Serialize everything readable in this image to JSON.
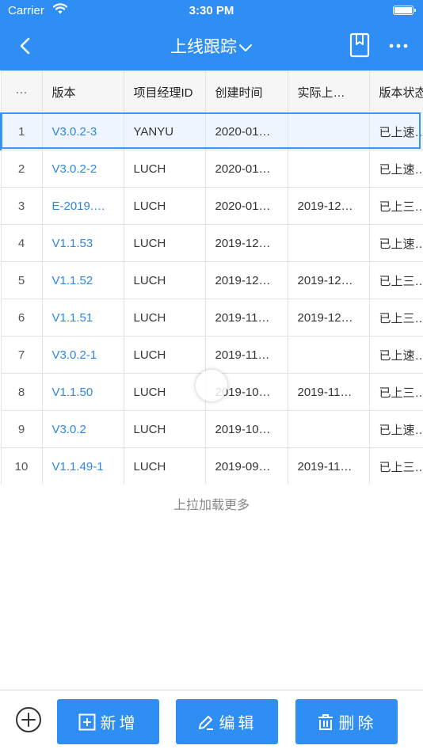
{
  "status": {
    "carrier": "Carrier",
    "time": "3:30 PM"
  },
  "nav": {
    "title": "上线跟踪"
  },
  "table": {
    "columns": [
      "···",
      "版本",
      "项目经理ID",
      "创建时间",
      "实际上…",
      "版本状态"
    ],
    "rows": [
      {
        "idx": "1",
        "version": "V3.0.2-3",
        "pm": "YANYU",
        "created": "2020-01…",
        "actual": "",
        "state": "已上速…"
      },
      {
        "idx": "2",
        "version": "V3.0.2-2",
        "pm": "LUCH",
        "created": "2020-01…",
        "actual": "",
        "state": "已上速…"
      },
      {
        "idx": "3",
        "version": "E-2019.…",
        "pm": "LUCH",
        "created": "2020-01…",
        "actual": "2019-12…",
        "state": "已上三…"
      },
      {
        "idx": "4",
        "version": "V1.1.53",
        "pm": "LUCH",
        "created": "2019-12…",
        "actual": "",
        "state": "已上速…"
      },
      {
        "idx": "5",
        "version": "V1.1.52",
        "pm": "LUCH",
        "created": "2019-12…",
        "actual": "2019-12…",
        "state": "已上三…"
      },
      {
        "idx": "6",
        "version": "V1.1.51",
        "pm": "LUCH",
        "created": "2019-11…",
        "actual": "2019-12…",
        "state": "已上三…"
      },
      {
        "idx": "7",
        "version": "V3.0.2-1",
        "pm": "LUCH",
        "created": "2019-11…",
        "actual": "",
        "state": "已上速…"
      },
      {
        "idx": "8",
        "version": "V1.1.50",
        "pm": "LUCH",
        "created": "2019-10…",
        "actual": "2019-11…",
        "state": "已上三…"
      },
      {
        "idx": "9",
        "version": "V3.0.2",
        "pm": "LUCH",
        "created": "2019-10…",
        "actual": "",
        "state": "已上速…"
      },
      {
        "idx": "10",
        "version": "V1.1.49-1",
        "pm": "LUCH",
        "created": "2019-09…",
        "actual": "2019-11…",
        "state": "已上三…"
      }
    ]
  },
  "load_more": "上拉加载更多",
  "actions": {
    "add": "新增",
    "edit": "编辑",
    "delete": "删除"
  },
  "colors": {
    "primary": "#2e8ef3",
    "link": "#2e86e6",
    "selected_row": "#eef5fe"
  },
  "icons": {
    "back": "chevron-left-icon",
    "title_dropdown": "chevron-down-icon",
    "bookmark": "bookmark-icon",
    "more": "more-icon",
    "add_circle": "plus-circle-icon",
    "add_button": "plus-square-icon",
    "edit_button": "pencil-icon",
    "delete_button": "trash-icon"
  }
}
